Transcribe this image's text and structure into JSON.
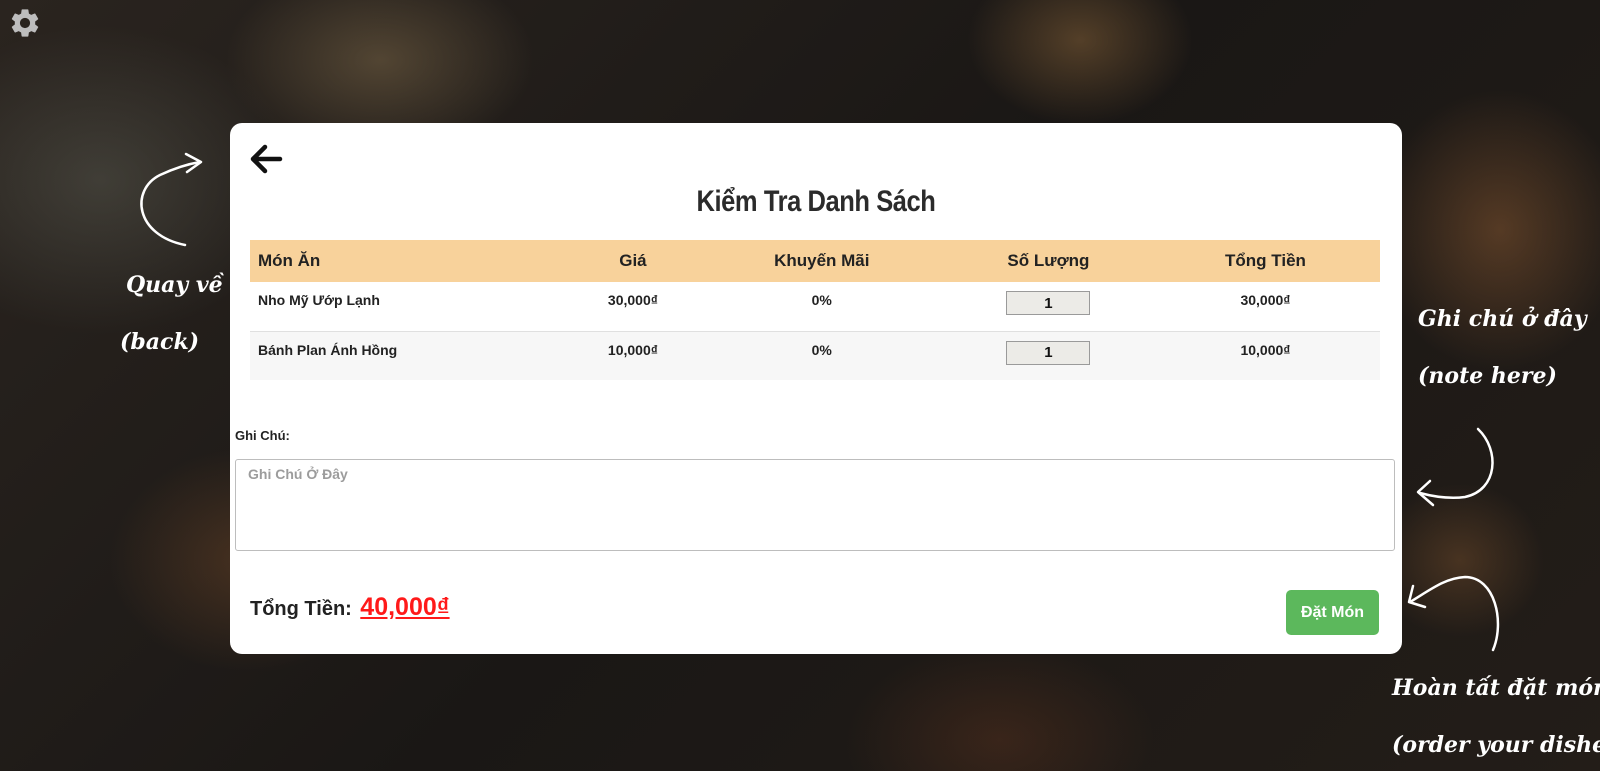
{
  "settings": {
    "icon": "gear-icon"
  },
  "card": {
    "back_icon": "arrow-left-icon",
    "title": "Kiểm Tra Danh Sách",
    "table": {
      "headers": [
        "Món Ăn",
        "Giá",
        "Khuyến Mãi",
        "Số Lượng",
        "Tổng Tiền"
      ],
      "rows": [
        {
          "name": "Nho Mỹ Ướp Lạnh",
          "price": "30,000₫",
          "discount": "0%",
          "quantity": "1",
          "total": "30,000₫"
        },
        {
          "name": "Bánh Plan Ánh Hồng",
          "price": "10,000₫",
          "discount": "0%",
          "quantity": "1",
          "total": "10,000₫"
        }
      ]
    },
    "note": {
      "label": "Ghi Chú:",
      "placeholder": "Ghi Chú Ở Đây",
      "value": ""
    },
    "total": {
      "label": "Tổng Tiền:",
      "value": "40,000₫"
    },
    "order_button": "Đặt Món"
  },
  "hints": {
    "back_line1": "Quay về",
    "back_line2": "(back)",
    "note_line1": "Ghi chú ở đây",
    "note_line2": "(note here)",
    "order_line1": "Hoàn tất đặt món",
    "order_line2": "(order your dishes)"
  },
  "colors": {
    "header_bg": "#f8d29b",
    "total_red": "#ff1a1a",
    "button_green": "#5cb85c"
  }
}
